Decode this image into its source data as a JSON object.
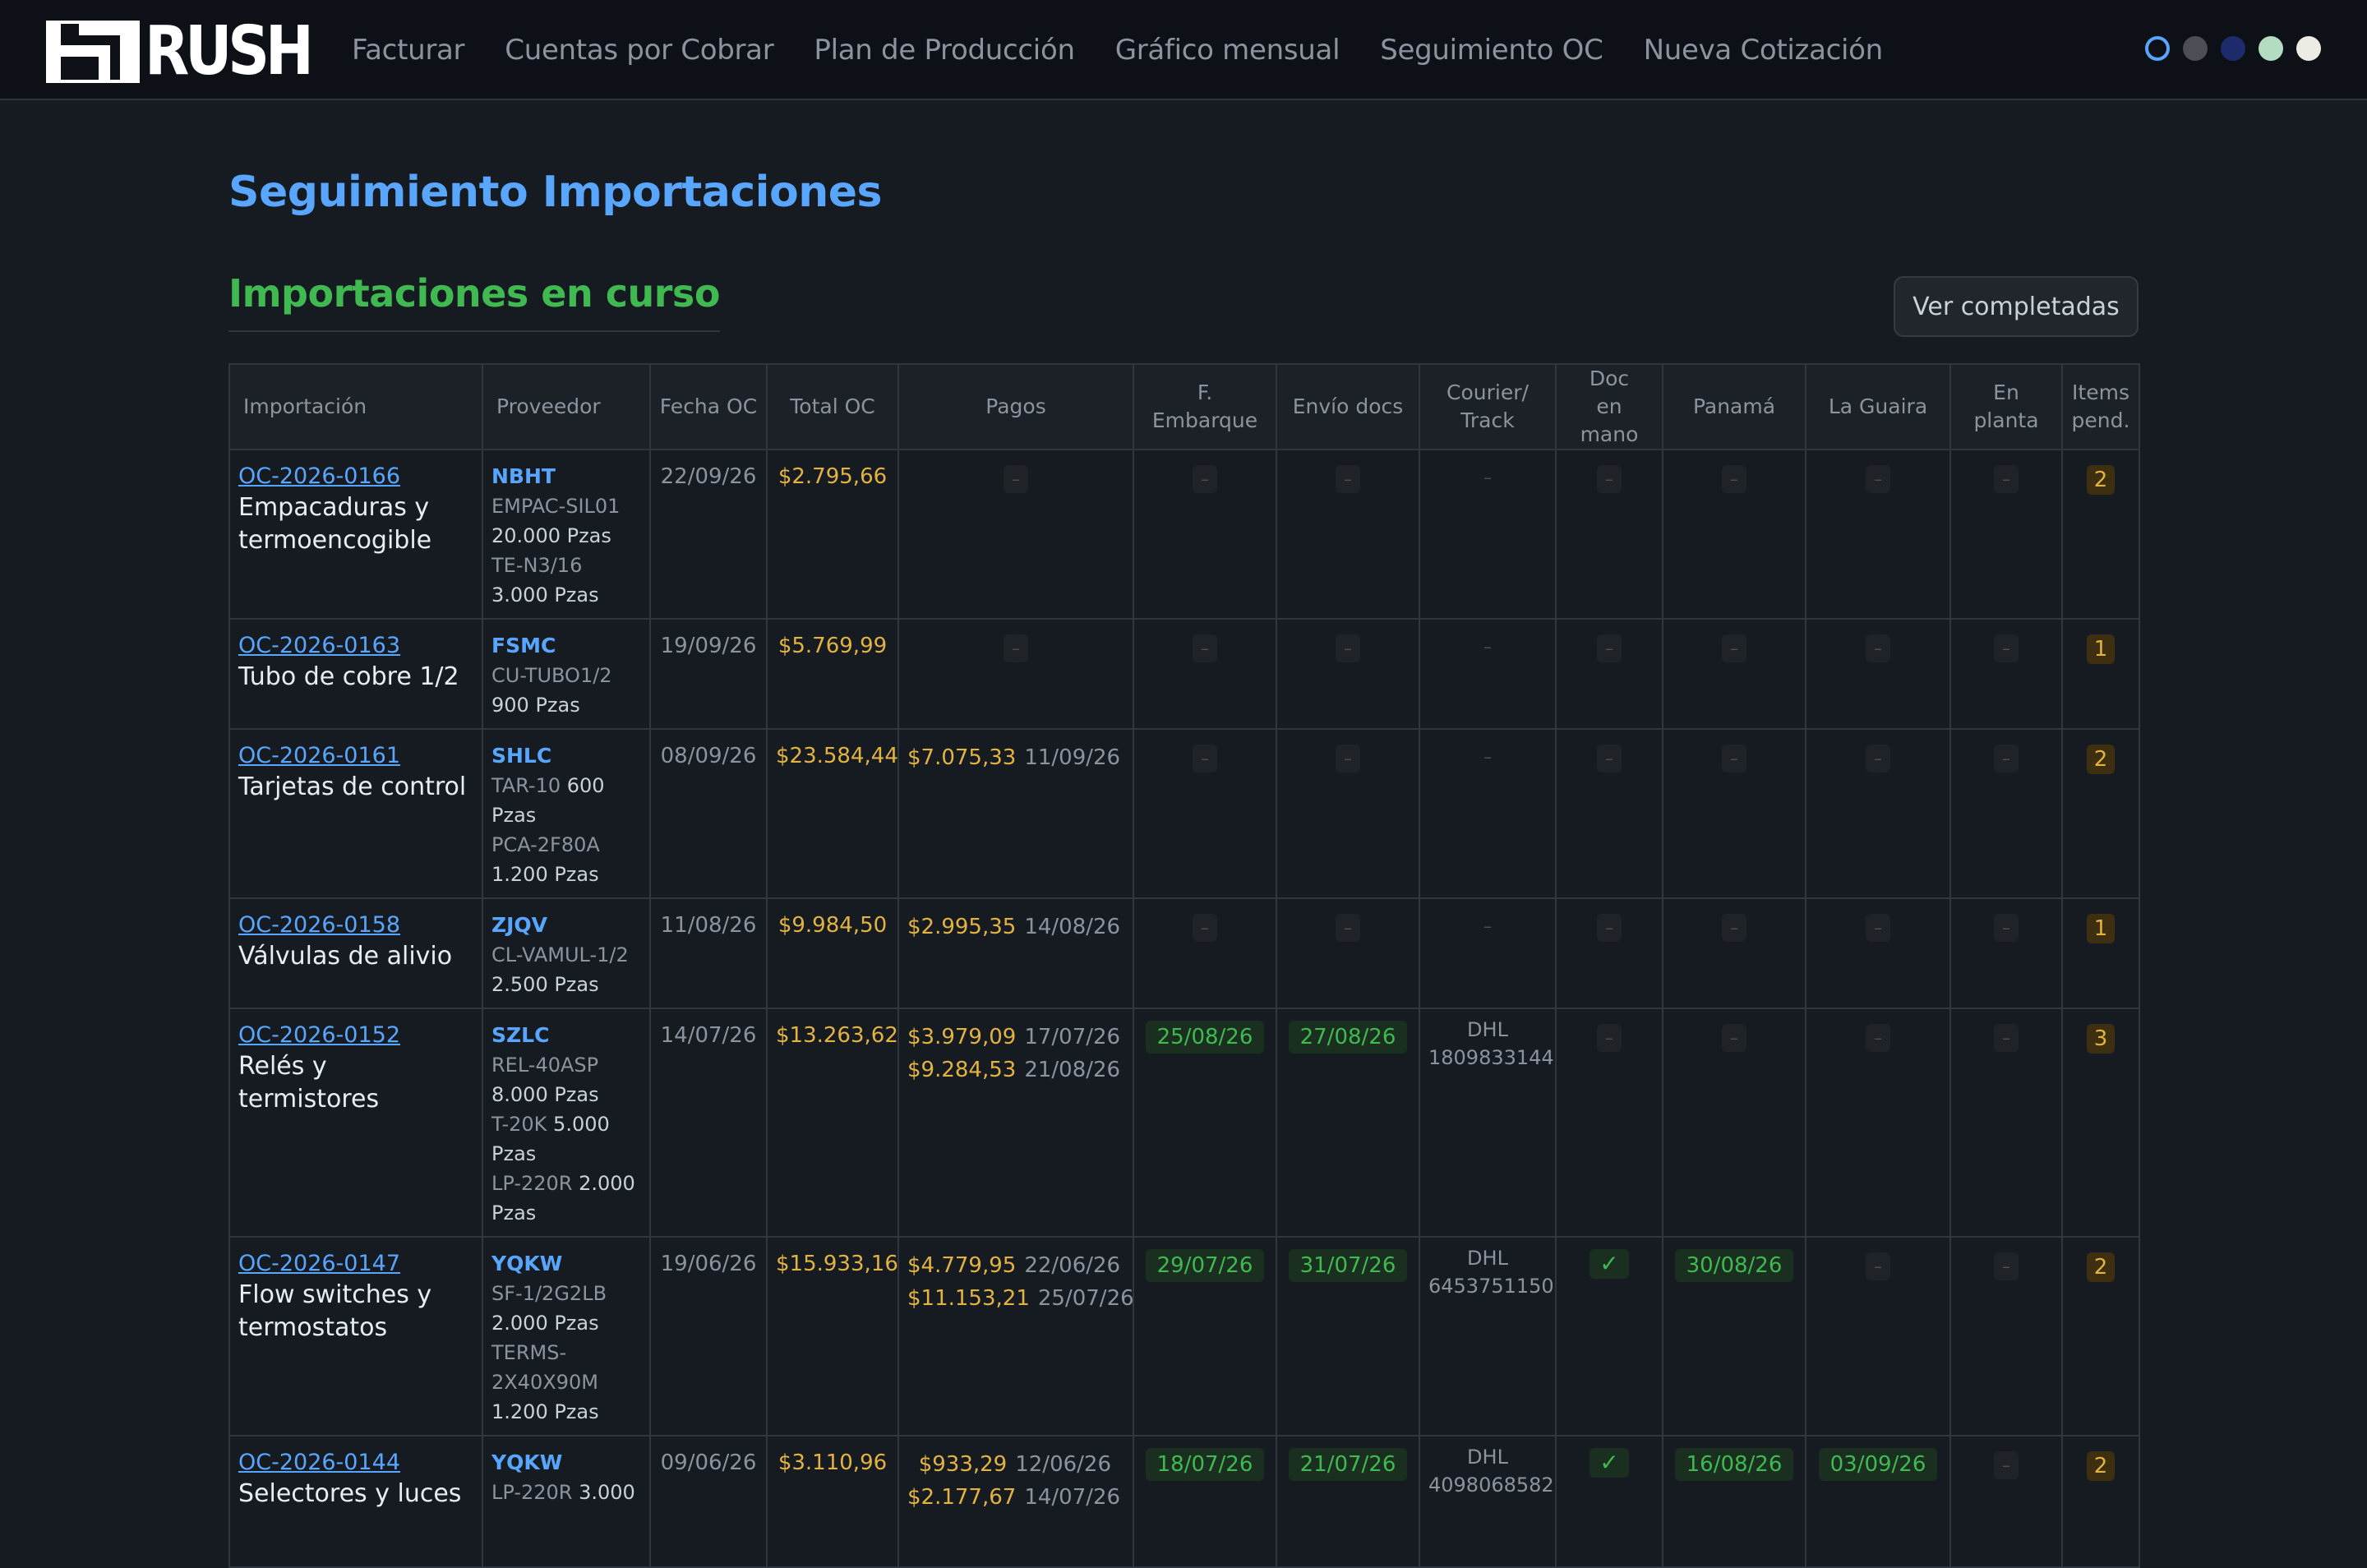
{
  "app": {
    "logo_text": "RUSH"
  },
  "nav": [
    {
      "label": "Facturar"
    },
    {
      "label": "Cuentas por Cobrar"
    },
    {
      "label": "Plan de Producción"
    },
    {
      "label": "Gráfico mensual"
    },
    {
      "label": "Seguimiento OC"
    },
    {
      "label": "Nueva Cotización"
    }
  ],
  "themes": [
    {
      "color": "#58a6ff",
      "selected": true
    },
    {
      "color": "#4b4f55"
    },
    {
      "color": "#1d2a6b"
    },
    {
      "color": "#b3dcc0"
    },
    {
      "color": "#eeeae4"
    }
  ],
  "page": {
    "title": "Seguimiento Importaciones",
    "section_title": "Importaciones en curso",
    "completed_button": "Ver completadas"
  },
  "table": {
    "headers": {
      "importacion": "Importación",
      "proveedor": "Proveedor",
      "fecha_oc": "Fecha OC",
      "total_oc": "Total OC",
      "pagos": "Pagos",
      "f_embarque": "F. Embarque",
      "envio_docs": "Envío docs",
      "courier_1": "Courier/",
      "courier_2": "Track",
      "doc_1": "Doc",
      "doc_2": "en mano",
      "panama": "Panamá",
      "la_guaira": "La Guaira",
      "en_planta": "En planta",
      "items_1": "Items",
      "items_2": "pend."
    },
    "dash": "–",
    "check": "✓",
    "rows": [
      {
        "oc": "OC-2026-0166",
        "desc": "Empacaduras y termoencogible",
        "supplier": "NBHT",
        "items": [
          {
            "code": "EMPAC-SIL01",
            "qty": "20.000 Pzas"
          },
          {
            "code": "TE-N3/16",
            "qty": "3.000 Pzas"
          }
        ],
        "fecha": "22/09/26",
        "total": "$2.795,66",
        "pagos": [],
        "embarque": "",
        "envio": "",
        "courier": "",
        "track": "",
        "doc": false,
        "panama": "",
        "guaira": "",
        "planta": "",
        "pend": "2"
      },
      {
        "oc": "OC-2026-0163",
        "desc": "Tubo de cobre 1/2",
        "supplier": "FSMC",
        "items": [
          {
            "code": "CU-TUBO1/2",
            "qty": "900 Pzas"
          }
        ],
        "fecha": "19/09/26",
        "total": "$5.769,99",
        "pagos": [],
        "embarque": "",
        "envio": "",
        "courier": "",
        "track": "",
        "doc": false,
        "panama": "",
        "guaira": "",
        "planta": "",
        "pend": "1"
      },
      {
        "oc": "OC-2026-0161",
        "desc": "Tarjetas de control",
        "supplier": "SHLC",
        "items": [
          {
            "code": "TAR-10",
            "qty": "600 Pzas"
          },
          {
            "code": "PCA-2F80A",
            "qty": "1.200 Pzas"
          }
        ],
        "fecha": "08/09/26",
        "total": "$23.584,44",
        "pagos": [
          {
            "amount": "$7.075,33",
            "date": "11/09/26"
          }
        ],
        "embarque": "",
        "envio": "",
        "courier": "",
        "track": "",
        "doc": false,
        "panama": "",
        "guaira": "",
        "planta": "",
        "pend": "2"
      },
      {
        "oc": "OC-2026-0158",
        "desc": "Válvulas de alivio",
        "supplier": "ZJQV",
        "items": [
          {
            "code": "CL-VAMUL-1/2",
            "qty": "2.500 Pzas"
          }
        ],
        "fecha": "11/08/26",
        "total": "$9.984,50",
        "pagos": [
          {
            "amount": "$2.995,35",
            "date": "14/08/26"
          }
        ],
        "embarque": "",
        "envio": "",
        "courier": "",
        "track": "",
        "doc": false,
        "panama": "",
        "guaira": "",
        "planta": "",
        "pend": "1"
      },
      {
        "oc": "OC-2026-0152",
        "desc": "Relés y termistores",
        "supplier": "SZLC",
        "items": [
          {
            "code": "REL-40ASP",
            "qty": "8.000 Pzas"
          },
          {
            "code": "T-20K",
            "qty": "5.000 Pzas"
          },
          {
            "code": "LP-220R",
            "qty": "2.000 Pzas"
          }
        ],
        "fecha": "14/07/26",
        "total": "$13.263,62",
        "pagos": [
          {
            "amount": "$3.979,09",
            "date": "17/07/26"
          },
          {
            "amount": "$9.284,53",
            "date": "21/08/26"
          }
        ],
        "embarque": "25/08/26",
        "envio": "27/08/26",
        "courier": "DHL",
        "track": "1809833144",
        "doc": false,
        "panama": "",
        "guaira": "",
        "planta": "",
        "pend": "3"
      },
      {
        "oc": "OC-2026-0147",
        "desc": "Flow switches y termostatos",
        "supplier": "YQKW",
        "items": [
          {
            "code": "SF-1/2G2LB",
            "qty": "2.000 Pzas"
          },
          {
            "code": "TERMS-2X40X90M",
            "qty": "1.200 Pzas"
          }
        ],
        "fecha": "19/06/26",
        "total": "$15.933,16",
        "pagos": [
          {
            "amount": "$4.779,95",
            "date": "22/06/26"
          },
          {
            "amount": "$11.153,21",
            "date": "25/07/26"
          }
        ],
        "embarque": "29/07/26",
        "envio": "31/07/26",
        "courier": "DHL",
        "track": "6453751150",
        "doc": true,
        "panama": "30/08/26",
        "guaira": "",
        "planta": "",
        "pend": "2"
      },
      {
        "oc": "OC-2026-0144",
        "desc": "Selectores y luces",
        "supplier": "YQKW",
        "items": [
          {
            "code": "LP-220R",
            "qty": "3.000"
          }
        ],
        "fecha": "09/06/26",
        "total": "$3.110,96",
        "pagos": [
          {
            "amount": "$933,29",
            "date": "12/06/26"
          },
          {
            "amount": "$2.177,67",
            "date": "14/07/26"
          }
        ],
        "embarque": "18/07/26",
        "envio": "21/07/26",
        "courier": "DHL",
        "track": "4098068582",
        "doc": true,
        "panama": "16/08/26",
        "guaira": "03/09/26",
        "planta": "",
        "pend": "2"
      }
    ]
  }
}
